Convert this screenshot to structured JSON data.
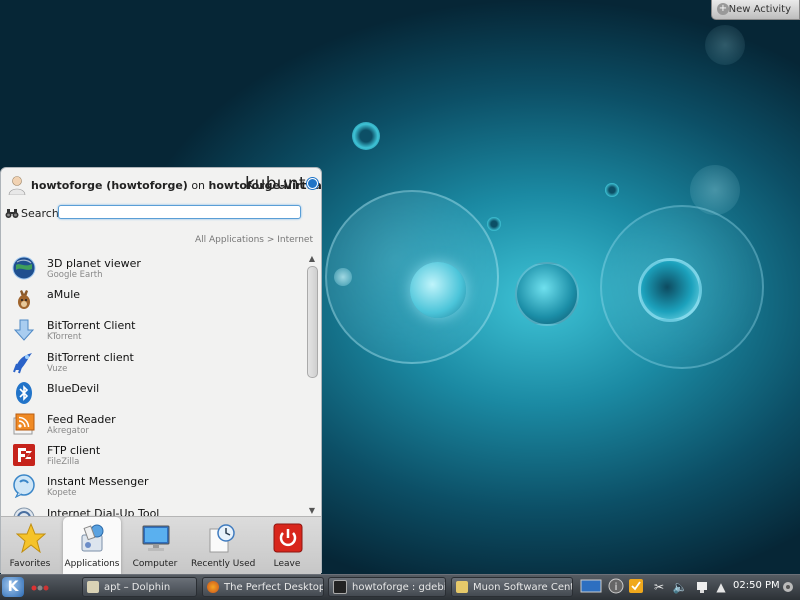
{
  "desktop": {
    "new_activity_label": "New Activity"
  },
  "launcher": {
    "user_display": "howtoforge (howtoforge)",
    "on_text": "on",
    "host": "howtoforge-Virtua",
    "brand": "kubuntu",
    "search": {
      "label": "Search:",
      "value": ""
    },
    "breadcrumb": {
      "parent": "All Applications >",
      "current": "Internet"
    },
    "apps": [
      {
        "name": "3D planet viewer",
        "desc": "Google Earth",
        "icon": "globe-icon"
      },
      {
        "name": "aMule",
        "desc": "",
        "icon": "amule-icon"
      },
      {
        "name": "BitTorrent Client",
        "desc": "KTorrent",
        "icon": "ktorrent-icon"
      },
      {
        "name": "BitTorrent client",
        "desc": "Vuze",
        "icon": "vuze-frog-icon"
      },
      {
        "name": "BlueDevil",
        "desc": "",
        "icon": "bluetooth-icon"
      },
      {
        "name": "Feed Reader",
        "desc": "Akregator",
        "icon": "rss-feed-icon"
      },
      {
        "name": "FTP client",
        "desc": "FileZilla",
        "icon": "filezilla-icon"
      },
      {
        "name": "Instant Messenger",
        "desc": "Kopete",
        "icon": "chat-bubble-icon"
      },
      {
        "name": "Internet Dial-Up Tool",
        "desc": "",
        "icon": "dialup-icon"
      }
    ],
    "tabs": [
      {
        "label": "Favorites",
        "icon": "star-icon"
      },
      {
        "label": "Applications",
        "icon": "applications-icon"
      },
      {
        "label": "Computer",
        "icon": "monitor-icon"
      },
      {
        "label": "Recently Used",
        "icon": "clock-document-icon"
      },
      {
        "label": "Leave",
        "icon": "power-icon"
      }
    ],
    "active_tab": "Applications"
  },
  "taskbar": {
    "tasks": [
      {
        "label": "apt – Dolphin",
        "icon": "folder-icon"
      },
      {
        "label": "The Perfect Desktop",
        "icon": "firefox-icon"
      },
      {
        "label": "howtoforge : gdebi",
        "icon": "terminal-icon"
      },
      {
        "label": "Muon Software Center",
        "icon": "package-icon"
      }
    ],
    "clock": "02:50 PM"
  },
  "colors": {
    "accent": "#1f74c7",
    "desktop_center": "#3ec3d6",
    "desktop_edge": "#062636",
    "leave_red": "#d8261c"
  }
}
